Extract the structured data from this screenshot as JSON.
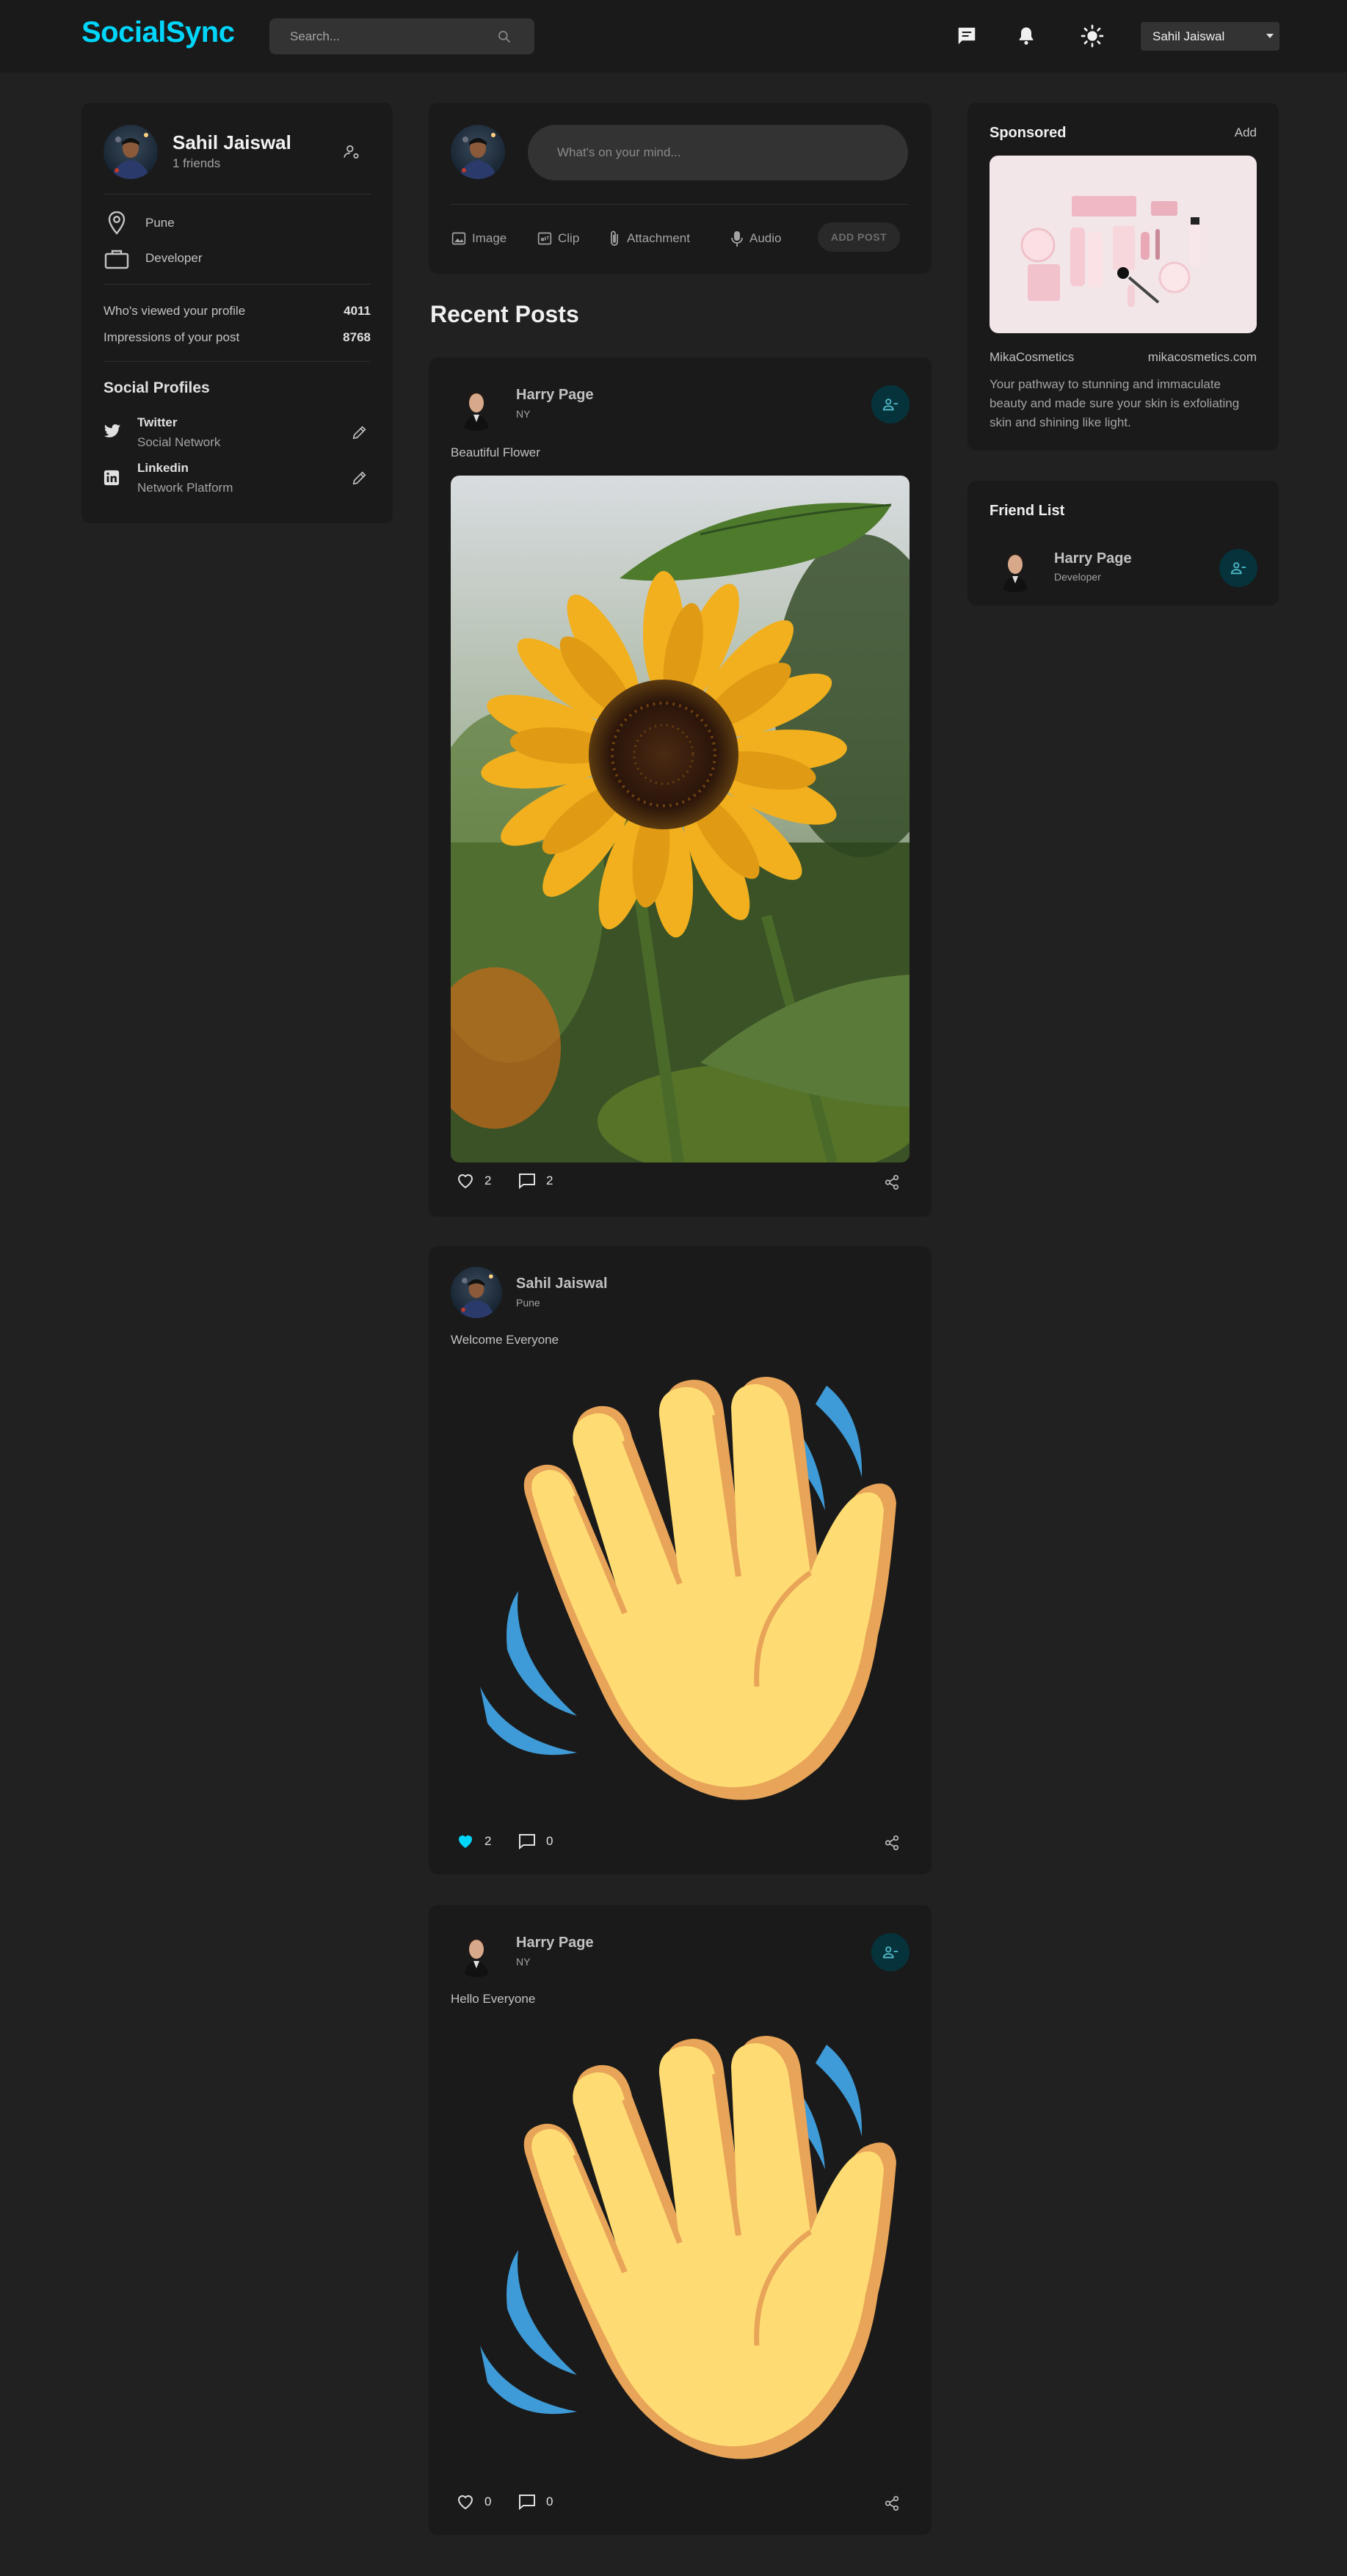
{
  "navbar": {
    "brand": "SocialSync",
    "search_placeholder": "Search...",
    "user_select_value": "Sahil Jaiswal",
    "icons": [
      "message-icon",
      "notifications-icon",
      "light-mode-icon",
      "search-icon"
    ]
  },
  "profile": {
    "name": "Sahil Jaiswal",
    "friends_text": "1 friends",
    "location": "Pune",
    "occupation": "Developer",
    "viewed_label": "Who's viewed your profile",
    "viewed_value": "4011",
    "impressions_label": "Impressions of your post",
    "impressions_value": "8768",
    "social_title": "Social Profiles",
    "socials": [
      {
        "name": "Twitter",
        "desc": "Social Network",
        "icon": "twitter-icon"
      },
      {
        "name": "Linkedin",
        "desc": "Network Platform",
        "icon": "linkedin-icon"
      }
    ]
  },
  "composer": {
    "placeholder": "What's on your mind...",
    "tools": [
      "Image",
      "Clip",
      "Attachment",
      "Audio"
    ],
    "add_post": "ADD POST"
  },
  "feed": {
    "title": "Recent Posts",
    "posts": [
      {
        "author": "Harry Page",
        "location": "NY",
        "description": "Beautiful Flower",
        "likes": "2",
        "comments": "2",
        "liked": false,
        "image": "sunflower-photo"
      },
      {
        "author": "Sahil Jaiswal",
        "location": "Pune",
        "description": "Welcome Everyone",
        "likes": "2",
        "comments": "0",
        "liked": true,
        "image": "waving-hand-emoji"
      },
      {
        "author": "Harry Page",
        "location": "NY",
        "description": "Hello Everyone",
        "likes": "0",
        "comments": "0",
        "liked": false,
        "image": "waving-hand-emoji"
      }
    ]
  },
  "sponsored": {
    "title": "Sponsored",
    "add": "Add",
    "brand": "MikaCosmetics",
    "website": "mikacosmetics.com",
    "description": "Your pathway to stunning and immaculate beauty and made sure your skin is exfoliating skin and shining like light."
  },
  "friend_list": {
    "title": "Friend List",
    "friends": [
      {
        "name": "Harry Page",
        "occupation": "Developer"
      }
    ]
  },
  "colors": {
    "accent": "#00d5fa",
    "background": "#212121",
    "card": "#1a1a1a",
    "liked": "#00d5fa"
  }
}
